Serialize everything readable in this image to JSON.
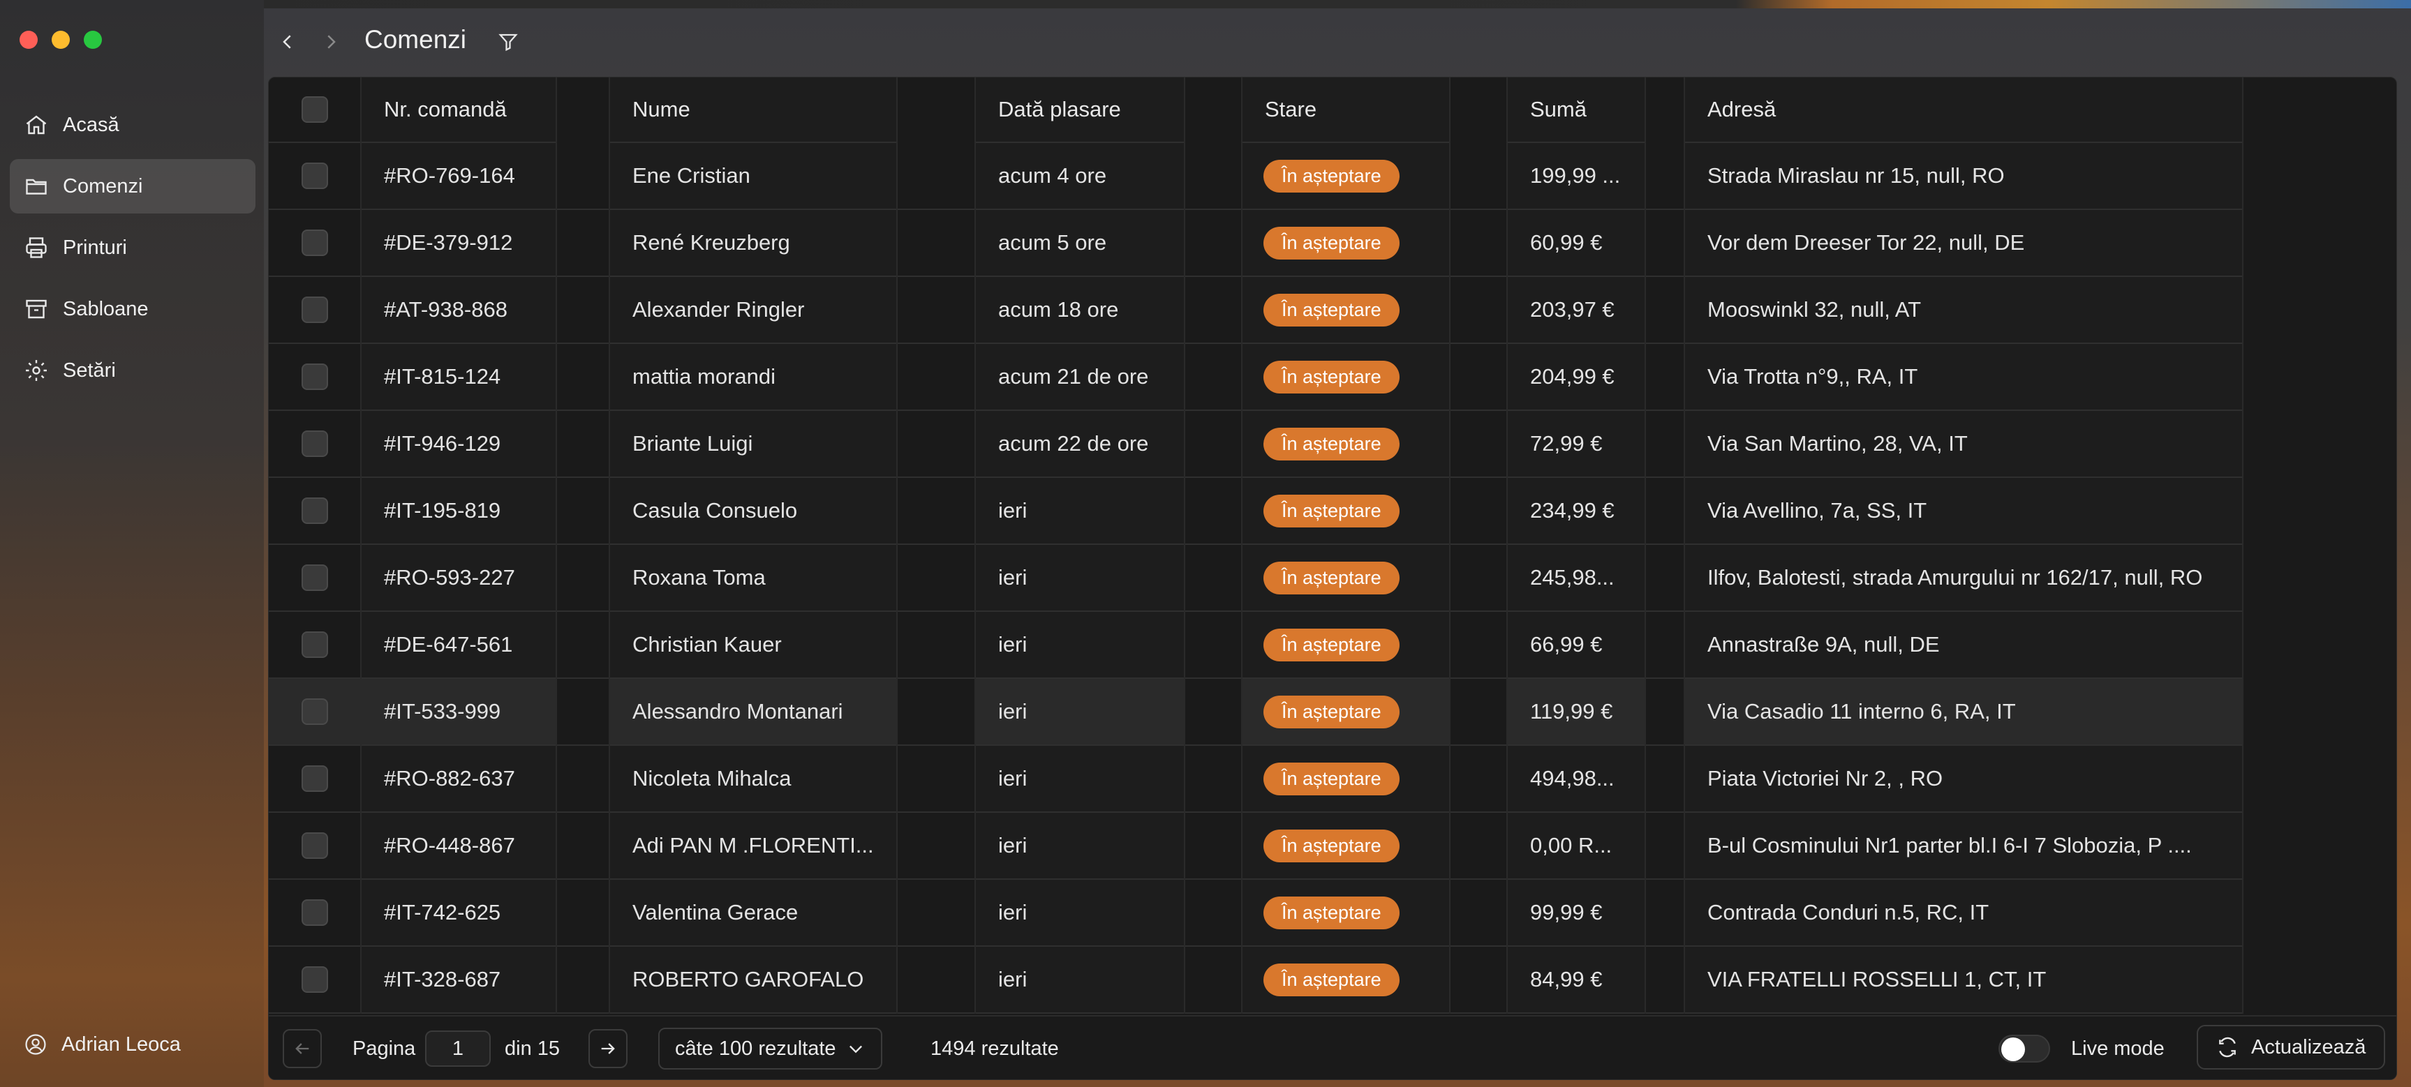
{
  "app": {
    "header_title": "Comenzi"
  },
  "sidebar": {
    "items": [
      {
        "label": "Acasă",
        "icon": "home-icon",
        "active": false
      },
      {
        "label": "Comenzi",
        "icon": "folder-icon",
        "active": true
      },
      {
        "label": "Printuri",
        "icon": "printer-icon",
        "active": false
      },
      {
        "label": "Sabloane",
        "icon": "archive-icon",
        "active": false
      },
      {
        "label": "Setări",
        "icon": "gear-icon",
        "active": false
      }
    ],
    "user_name": "Adrian Leoca"
  },
  "table": {
    "headers": {
      "order_no": "Nr. comandă",
      "name": "Nume",
      "date": "Dată plasare",
      "status": "Stare",
      "sum": "Sumă",
      "address": "Adresă"
    },
    "rows": [
      {
        "order_no": "#RO-769-164",
        "name": "Ene Cristian",
        "date": "acum 4 ore",
        "status": "În așteptare",
        "sum": "199,99 ...",
        "address": "Strada Miraslau nr 15, null, RO"
      },
      {
        "order_no": "#DE-379-912",
        "name": "René Kreuzberg",
        "date": "acum 5 ore",
        "status": "În așteptare",
        "sum": "60,99 €",
        "address": "Vor dem Dreeser Tor 22, null, DE"
      },
      {
        "order_no": "#AT-938-868",
        "name": "Alexander Ringler",
        "date": "acum 18 ore",
        "status": "În așteptare",
        "sum": "203,97 €",
        "address": "Mooswinkl 32, null, AT"
      },
      {
        "order_no": "#IT-815-124",
        "name": "mattia morandi",
        "date": "acum 21 de ore",
        "status": "În așteptare",
        "sum": "204,99 €",
        "address": "Via Trotta n°9,, RA, IT"
      },
      {
        "order_no": "#IT-946-129",
        "name": "Briante Luigi",
        "date": "acum 22 de ore",
        "status": "În așteptare",
        "sum": "72,99 €",
        "address": "Via San Martino, 28, VA, IT"
      },
      {
        "order_no": "#IT-195-819",
        "name": "Casula Consuelo",
        "date": "ieri",
        "status": "În așteptare",
        "sum": "234,99 €",
        "address": "Via Avellino, 7a, SS, IT"
      },
      {
        "order_no": "#RO-593-227",
        "name": "Roxana Toma",
        "date": "ieri",
        "status": "În așteptare",
        "sum": "245,98...",
        "address": "Ilfov, Balotesti, strada Amurgului nr 162/17, null, RO"
      },
      {
        "order_no": "#DE-647-561",
        "name": "Christian Kauer",
        "date": "ieri",
        "status": "În așteptare",
        "sum": "66,99 €",
        "address": "Annastraße 9A, null, DE"
      },
      {
        "order_no": "#IT-533-999",
        "name": "Alessandro Montanari",
        "date": "ieri",
        "status": "În așteptare",
        "sum": "119,99 €",
        "address": "Via Casadio 11 interno 6, RA, IT"
      },
      {
        "order_no": "#RO-882-637",
        "name": "Nicoleta Mihalca",
        "date": "ieri",
        "status": "În așteptare",
        "sum": "494,98...",
        "address": "Piata Victoriei Nr 2, , RO"
      },
      {
        "order_no": "#RO-448-867",
        "name": "Adi PAN M .FLORENTI...",
        "date": "ieri",
        "status": "În așteptare",
        "sum": "0,00 R...",
        "address": "B-ul Cosminului Nr1 parter bl.I 6-I 7 Slobozia, P ...."
      },
      {
        "order_no": "#IT-742-625",
        "name": "Valentina Gerace",
        "date": "ieri",
        "status": "În așteptare",
        "sum": "99,99 €",
        "address": "Contrada Conduri n.5, RC, IT"
      },
      {
        "order_no": "#IT-328-687",
        "name": "ROBERTO GAROFALO",
        "date": "ieri",
        "status": "În așteptare",
        "sum": "84,99 €",
        "address": "VIA FRATELLI ROSSELLI 1, CT, IT"
      }
    ],
    "status_color": "#d9782d"
  },
  "footer": {
    "page_label": "Pagina",
    "page_value": "1",
    "of_label": "din 15",
    "per_page": "câte 100 rezultate",
    "results": "1494 rezultate",
    "live_mode": "Live mode",
    "refresh": "Actualizează"
  }
}
